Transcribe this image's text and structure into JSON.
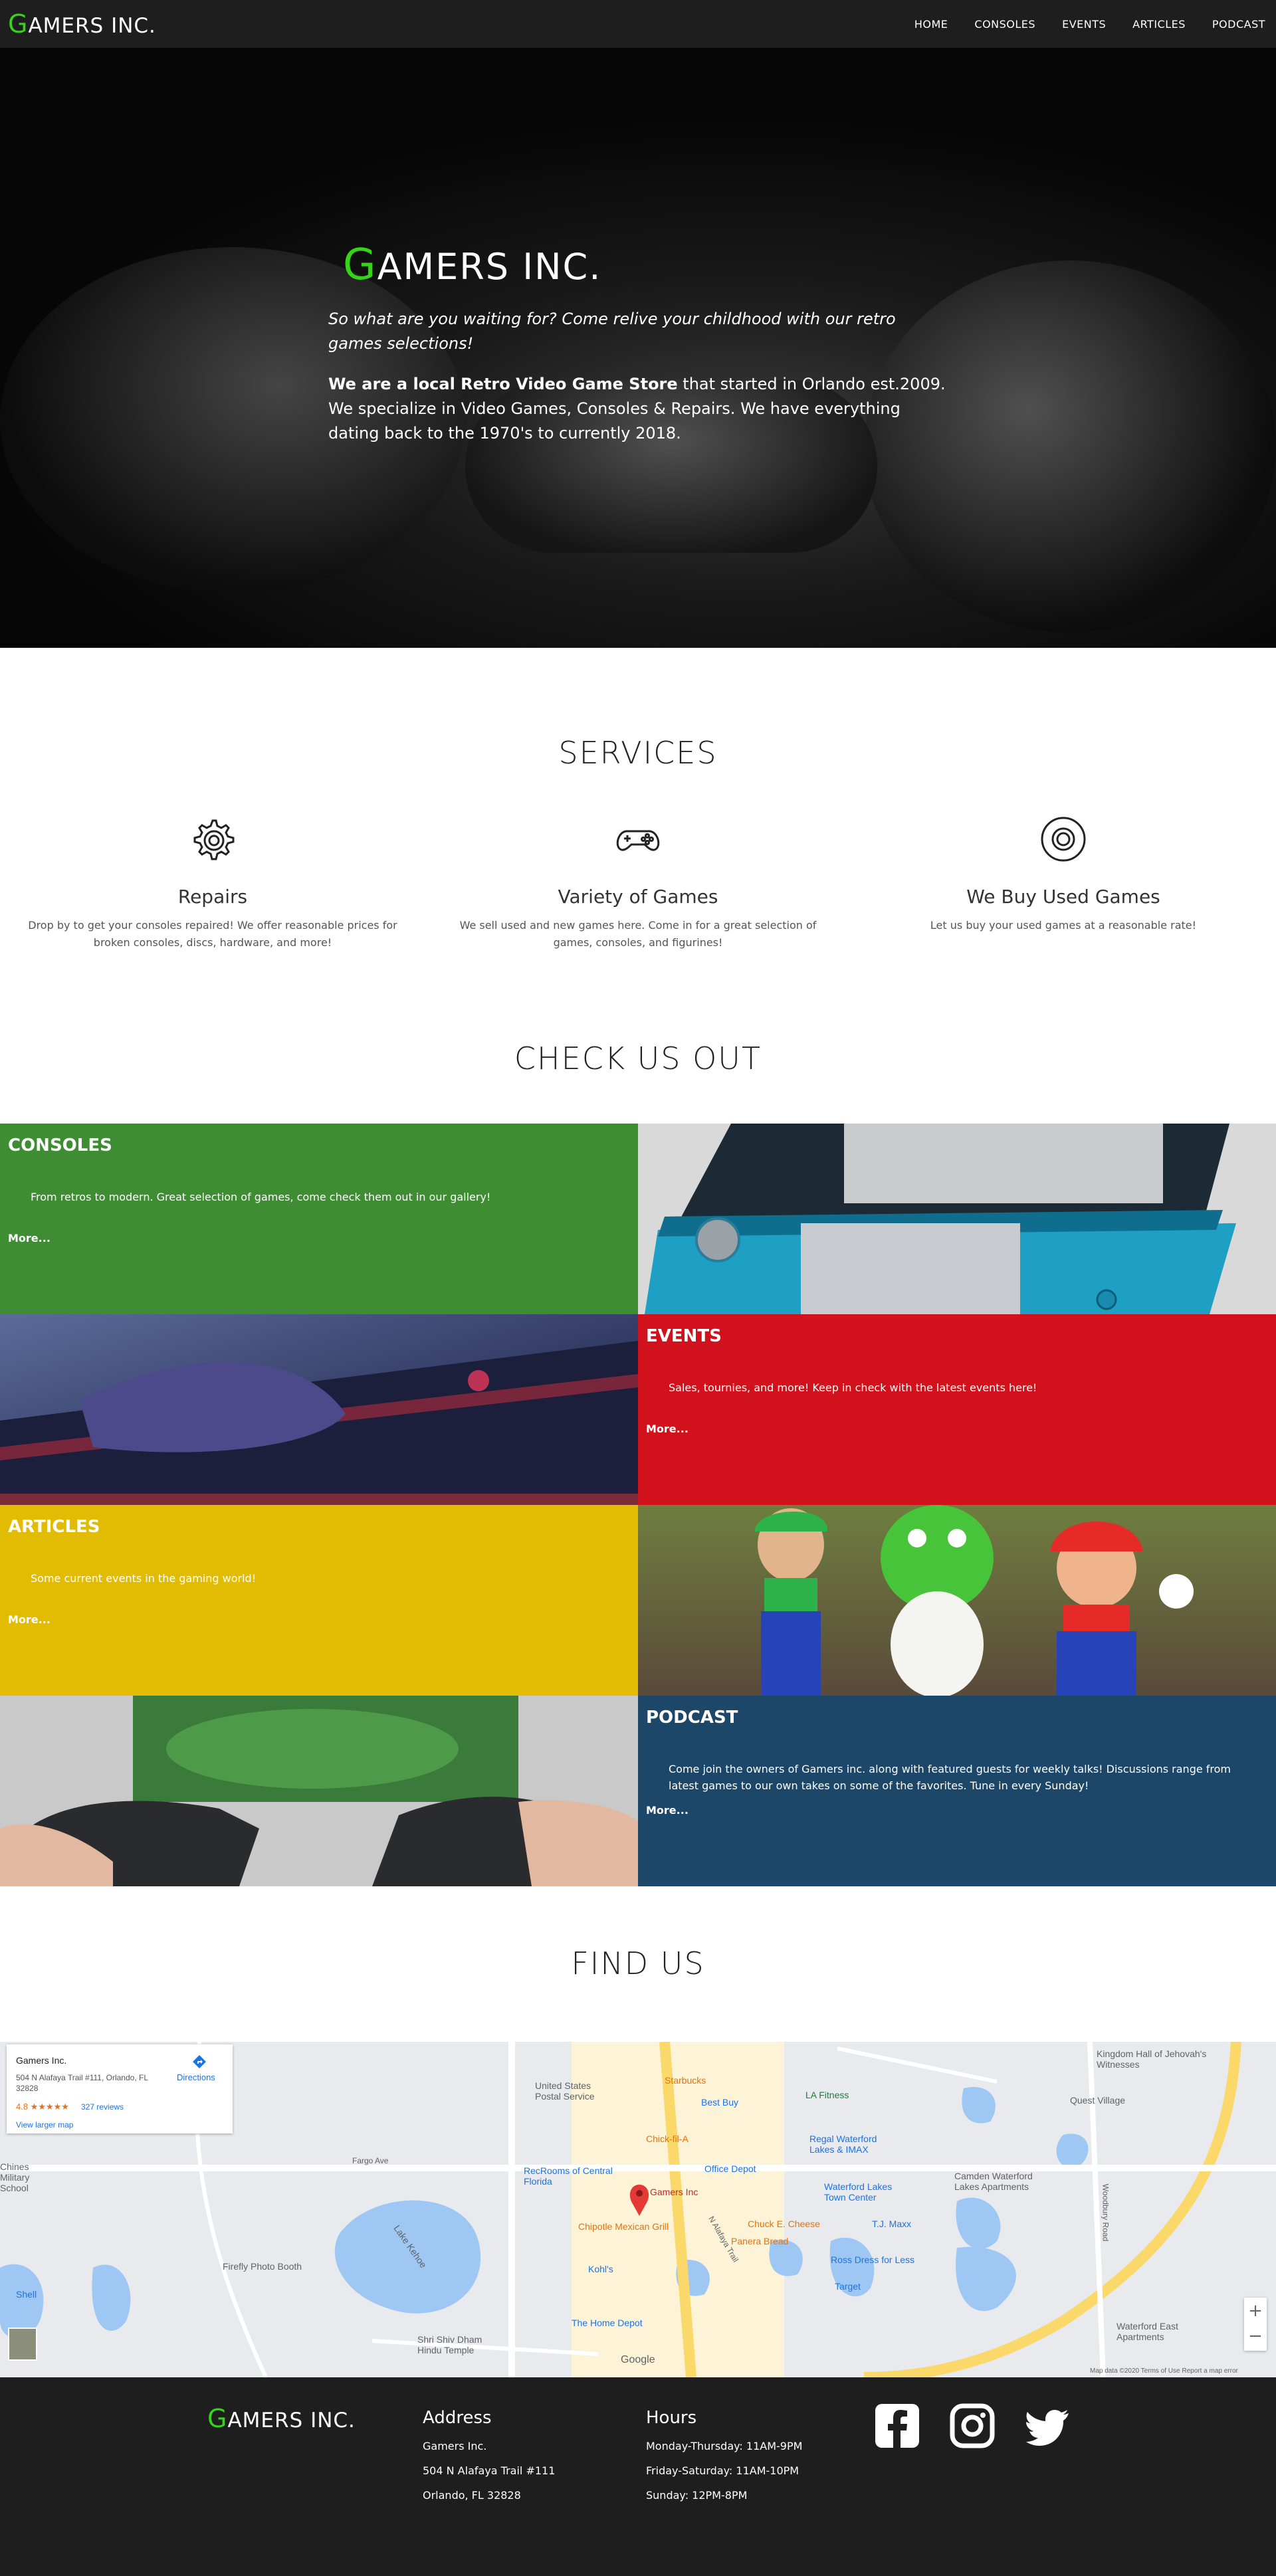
{
  "brand": {
    "first": "G",
    "rest": "AMERS INC."
  },
  "nav": [
    "HOME",
    "CONSOLES",
    "EVENTS",
    "ARTICLES",
    "PODCAST"
  ],
  "hero": {
    "tagline": "So what are you waiting for? Come relive your childhood with our retro games selections!",
    "desc_bold": "We are a local Retro Video Game Store",
    "desc_rest": " that started in Orlando est.2009. We specialize in Video Games, Consoles & Repairs. We have everything dating back to the 1970's to currently 2018."
  },
  "services": {
    "title": "SERVICES",
    "items": [
      {
        "icon": "gear-icon",
        "title": "Repairs",
        "text": "Drop by to get your consoles repaired! We offer reasonable prices for broken consoles, discs, hardware, and more!"
      },
      {
        "icon": "gamepad-icon",
        "title": "Variety of Games",
        "text": "We sell used and new games here. Come in for a great selection of games, consoles, and figurines!"
      },
      {
        "icon": "disc-icon",
        "title": "We Buy Used Games",
        "text": "Let us buy your used games at a reasonable rate!"
      }
    ]
  },
  "checkout": {
    "title": "CHECK US OUT",
    "more": "More...",
    "tiles": [
      {
        "title": "CONSOLES",
        "text": "From retros to modern. Great selection of games, come check them out in our gallery!",
        "color": "#3e8d33"
      },
      {
        "title": "EVENTS",
        "text": "Sales, tournies, and more! Keep in check with the latest events here!",
        "color": "#d1111b"
      },
      {
        "title": "ARTICLES",
        "text": "Some current events in the gaming world!",
        "color": "#e1bc03"
      },
      {
        "title": "PODCAST",
        "text": "Come join the owners of Gamers inc. along with featured guests for weekly talks! Discussions range from latest games to our own takes on some of the favorites. Tune in every Sunday!",
        "color": "#1c4769"
      }
    ]
  },
  "findus": {
    "title": "FIND US"
  },
  "map": {
    "card": {
      "name": "Gamers Inc.",
      "address": "504 N Alafaya Trail #111, Orlando, FL 32828",
      "rating": "4.8 ★★★★★",
      "reviews": "327 reviews",
      "larger": "View larger map",
      "directions": "Directions"
    },
    "pin_label": "Gamers Inc",
    "labels": [
      "Starbucks",
      "LA Fitness",
      "Best Buy",
      "Chick-fil-A",
      "Office Depot",
      "Regal Waterford Lakes & IMAX",
      "Waterford Lakes Town Center",
      "Chipotle Mexican Grill",
      "Chuck E. Cheese",
      "T.J. Maxx",
      "Panera Bread",
      "Kohl's",
      "Ross Dress for Less",
      "Target",
      "The Home Depot",
      "RecRooms of Central Florida",
      "United States Postal Service",
      "Lake Kehoe",
      "Firefly Photo Booth",
      "Shri Shiv Dham Hindu Temple",
      "Quest Village",
      "Camden Waterford Lakes Apartments",
      "Waterford East Apartments",
      "Kingdom Hall of Jehovah's Witnesses",
      "Chines Military School",
      "Shell",
      "Google",
      "Fargo Ave",
      "Woodbury Road",
      "N Alafaya Trail"
    ],
    "footer_text": "Map data ©2020   Terms of Use   Report a map error"
  },
  "footer": {
    "address_title": "Address",
    "address": [
      "Gamers Inc.",
      "504 N Alafaya Trail #111",
      "Orlando, FL 32828"
    ],
    "hours_title": "Hours",
    "hours": [
      "Monday-Thursday: 11AM-9PM",
      "Friday-Saturday: 11AM-10PM",
      "Sunday: 12PM-8PM"
    ],
    "social": [
      "facebook-icon",
      "instagram-icon",
      "twitter-icon"
    ]
  }
}
